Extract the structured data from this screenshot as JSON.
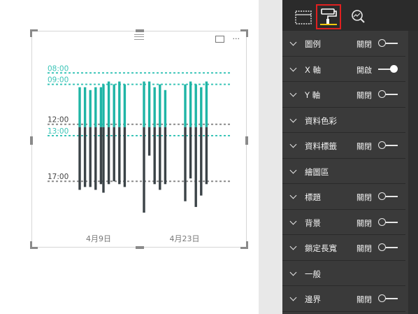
{
  "chart_data": {
    "type": "bar",
    "subtype": "floating-range",
    "x_tick_labels": [
      "4月9日",
      "4月23日"
    ],
    "y_axis_inverted": true,
    "y_range": [
      "07:00",
      "20:00"
    ],
    "reference_lines": [
      {
        "label": "08:00",
        "value": 8.0,
        "color": "#3cc5b8"
      },
      {
        "label": "09:00",
        "value": 9.0,
        "color": "#3cc5b8"
      },
      {
        "label": "12:00",
        "value": 12.5,
        "color": "#8a8a8a"
      },
      {
        "label": "13:00",
        "value": 13.5,
        "color": "#3cc5b8"
      },
      {
        "label": "17:00",
        "value": 17.5,
        "color": "#8a8a8a"
      }
    ],
    "series": [
      {
        "color": "#1fb5a6",
        "ranges": [
          [
            9.25,
            12.75
          ],
          [
            9.25,
            12.75
          ],
          [
            9.5,
            12.75
          ],
          [
            9.25,
            12.75
          ],
          [
            9.25,
            12.75
          ],
          [
            9.0,
            12.75
          ],
          [
            8.75,
            12.75
          ],
          [
            9.0,
            12.75
          ],
          [
            8.75,
            12.75
          ],
          [
            9.0,
            12.75
          ],
          [
            8.75,
            12.75
          ],
          [
            8.75,
            12.75
          ],
          [
            9.25,
            12.75
          ],
          [
            9.0,
            12.75
          ],
          [
            9.5,
            12.75
          ],
          [
            9.0,
            12.75
          ],
          [
            8.75,
            12.75
          ],
          [
            9.0,
            12.75
          ],
          [
            9.25,
            12.75
          ],
          [
            8.75,
            12.75
          ]
        ]
      },
      {
        "color": "#3b4347",
        "ranges": [
          [
            12.75,
            18.25
          ],
          [
            12.75,
            18.0
          ],
          [
            12.75,
            18.0
          ],
          [
            12.75,
            18.25
          ],
          [
            12.75,
            17.75
          ],
          [
            12.75,
            18.5
          ],
          [
            12.75,
            17.75
          ],
          [
            12.75,
            17.5
          ],
          [
            12.75,
            17.75
          ],
          [
            12.75,
            18.0
          ],
          [
            12.75,
            20.25
          ],
          [
            12.75,
            15.25
          ],
          [
            12.75,
            17.75
          ],
          [
            12.75,
            18.25
          ],
          [
            12.75,
            17.75
          ],
          [
            12.75,
            19.25
          ],
          [
            12.75,
            17.25
          ],
          [
            12.75,
            19.75
          ],
          [
            12.75,
            18.75
          ],
          [
            12.75,
            17.75
          ]
        ]
      }
    ],
    "grid": false,
    "legend": "none"
  },
  "visual": {
    "focus_icon": "focus-mode-icon",
    "more_icon": "more-options-icon",
    "more_glyph": "···"
  },
  "pane": {
    "tabs": [
      {
        "name": "fields-tab",
        "icon": "fields-icon"
      },
      {
        "name": "format-tab",
        "icon": "paint-roller-icon",
        "active": true
      },
      {
        "name": "analytics-tab",
        "icon": "analytics-magnifier-icon"
      }
    ],
    "rows": [
      {
        "label": "圖例",
        "state": "關閉",
        "toggle": "off"
      },
      {
        "label": "X 軸",
        "state": "開啟",
        "toggle": "on"
      },
      {
        "label": "Y 軸",
        "state": "關閉",
        "toggle": "off"
      },
      {
        "label": "資料色彩"
      },
      {
        "label": "資料標籤",
        "state": "關閉",
        "toggle": "off"
      },
      {
        "label": "繪圖區"
      },
      {
        "label": "標題",
        "state": "關閉",
        "toggle": "off"
      },
      {
        "label": "背景",
        "state": "關閉",
        "toggle": "off"
      },
      {
        "label": "鎖定長寬",
        "state": "關閉",
        "toggle": "off"
      },
      {
        "label": "一般"
      },
      {
        "label": "邊界",
        "state": "關閉",
        "toggle": "off"
      }
    ]
  },
  "colors": {
    "teal": "#1fb5a6",
    "dark_bar": "#3b4347",
    "pane_bg": "#3a3a3a",
    "highlight": "#e02020",
    "active_underline": "#f2c811"
  }
}
